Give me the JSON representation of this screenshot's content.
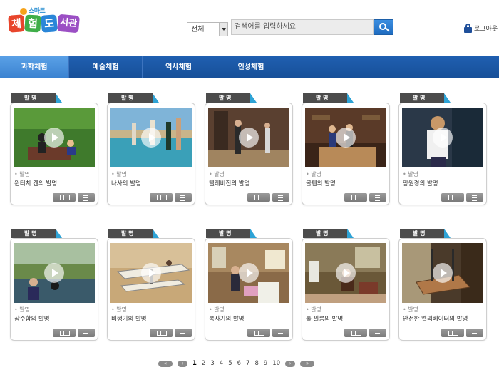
{
  "header": {
    "logo_small": "스마트",
    "logo_chars": [
      "체",
      "험",
      "도",
      "서관"
    ],
    "search": {
      "scope": "전체",
      "placeholder": "검색어를 입력하세요"
    },
    "logout_label": "로그아웃"
  },
  "nav": {
    "items": [
      {
        "label": "과학체험",
        "active": true
      },
      {
        "label": "예술체험",
        "active": false
      },
      {
        "label": "역사체험",
        "active": false
      },
      {
        "label": "인성체험",
        "active": false
      }
    ]
  },
  "cards": [
    {
      "tab": "발 명",
      "category": "발명",
      "title": "윈터치 켄의 발명"
    },
    {
      "tab": "발 명",
      "category": "발명",
      "title": "나사의 발명"
    },
    {
      "tab": "발 명",
      "category": "발명",
      "title": "텔레비전의 발명"
    },
    {
      "tab": "발 명",
      "category": "발명",
      "title": "볼펜의 발명"
    },
    {
      "tab": "발 명",
      "category": "발명",
      "title": "망원경의 발명"
    },
    {
      "tab": "발 명",
      "category": "발명",
      "title": "잠수함의 발명"
    },
    {
      "tab": "발 명",
      "category": "발명",
      "title": "비행기의 발명"
    },
    {
      "tab": "발 명",
      "category": "발명",
      "title": "복사기의 발명"
    },
    {
      "tab": "발 명",
      "category": "발명",
      "title": "롤 필름의 발명"
    },
    {
      "tab": "발 명",
      "category": "발명",
      "title": "안전한 엘리베이터의 발명"
    }
  ],
  "pagination": {
    "first": "«",
    "prev": "‹",
    "pages": [
      "1",
      "2",
      "3",
      "4",
      "5",
      "6",
      "7",
      "8",
      "9",
      "10"
    ],
    "current": "1",
    "next": "›",
    "last": "»"
  },
  "colors": {
    "nav_bg": "#1f5fb0",
    "nav_active": "#4a92dc",
    "tab_bg": "#4c4c4c",
    "tab_accent": "#2ea3d6",
    "search_button": "#2b7bd0"
  },
  "icons": {
    "search": "magnifier-icon",
    "logout": "lock-icon",
    "card_book": "book-icon",
    "card_list": "list-icon",
    "play": "play-icon"
  }
}
